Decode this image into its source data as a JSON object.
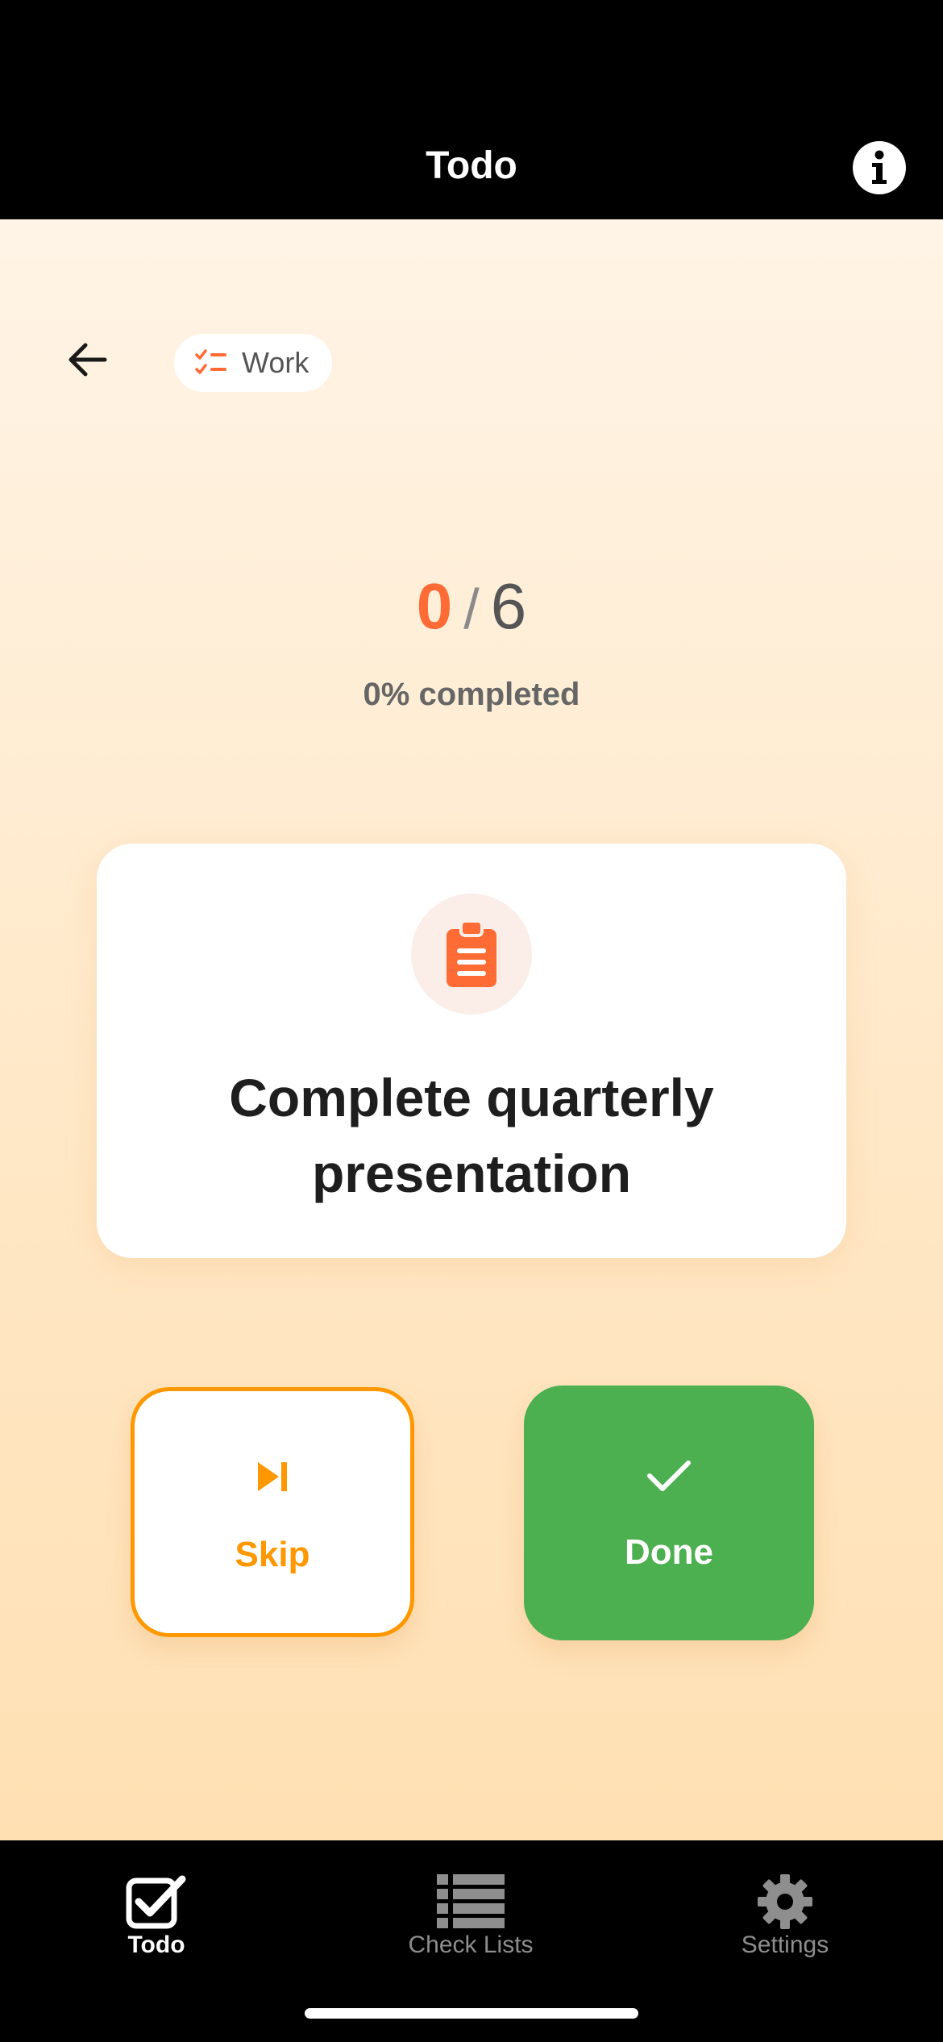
{
  "header": {
    "title": "Todo",
    "info_icon": "info-icon"
  },
  "nav": {
    "back_icon": "arrow-left-icon"
  },
  "category": {
    "label": "Work",
    "icon": "checklist-icon",
    "icon_color": "#ff6b35"
  },
  "progress": {
    "completed": "0",
    "separator": "/",
    "total": "6",
    "percent_text": "0% completed",
    "fraction": 0
  },
  "task": {
    "icon": "clipboard-icon",
    "title": "Complete quarterly presentation"
  },
  "actions": {
    "skip_label": "Skip",
    "skip_icon": "skip-next-icon",
    "done_label": "Done",
    "done_icon": "checkmark-icon"
  },
  "tabbar": {
    "tabs": [
      {
        "label": "Todo",
        "icon": "checkbox-icon",
        "active": true
      },
      {
        "label": "Check Lists",
        "icon": "list-icon",
        "active": false
      },
      {
        "label": "Settings",
        "icon": "gear-icon",
        "active": false
      }
    ]
  },
  "colors": {
    "accent_orange": "#ff6b35",
    "skip_orange": "#ff9800",
    "done_green": "#4caf50",
    "background_top": "#fff4e6",
    "background_bottom": "#ffe0b3"
  }
}
